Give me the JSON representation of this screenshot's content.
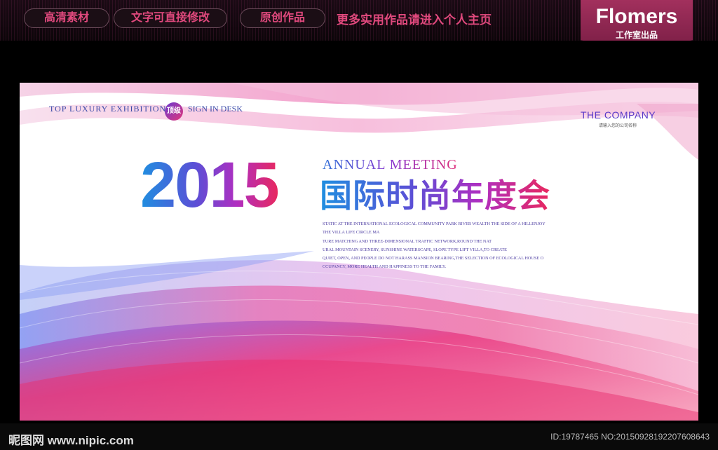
{
  "topbar": {
    "pills": [
      "高清素材",
      "文字可直接修改",
      "原创作品"
    ],
    "promo": "更多实用作品请进入个人主页",
    "brand_name": "Flomers",
    "brand_sub": "工作室出品"
  },
  "poster": {
    "tagline_left": "Top luxury exhibition",
    "badge": "顶级",
    "tagline_right": "Sign in desk",
    "company": "THE COMPANY",
    "company_sub": "请输入您的公司名称",
    "year": "2015",
    "annual": "Annual meeting",
    "title_cn": "国际时尚年度会",
    "body_lines": [
      "STATIC AT THE INTERNATIONAL ECOLOGICAL COMMUNITY PARK RIVER WEALTH THE SIDE OF A HILLENJOY",
      "THE VILLA LIFE CIRCLE MA",
      "TURE MATCHING AND THREE-DIMENSIONAL TRAFFIC NETWORK,ROUND THE NAT",
      "URAL MOUNTAIN SCENERY, SUNSHINE WATERSCAPE, SLOPE TYPE LIFT VILLA,TO CREATE",
      "QUIET, OPEN, AND PEOPLE DO NOT HARASS MANSION BEARING,THE SELECTION OF ECOLOGICAL HOUSE O",
      "CCUPANCY, MORE HEALTH AND HAPPINESS TO THE FAMILY."
    ]
  },
  "watermark": {
    "site": "昵图网 www.nipic.com",
    "id": "ID:19787465 NO:20150928192207608643"
  },
  "colors": {
    "accent_pink": "#e0497d",
    "brand_bg": "#a2305d",
    "blue": "#1f8fe0",
    "magenta": "#e8285e"
  }
}
